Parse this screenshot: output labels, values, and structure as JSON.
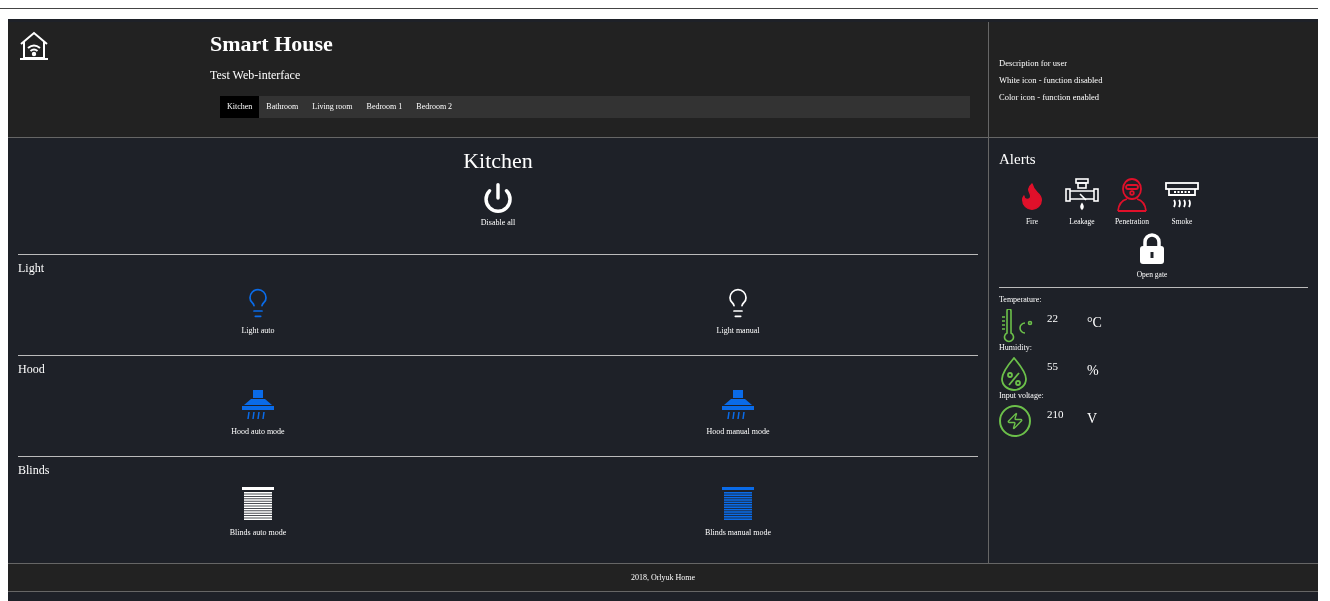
{
  "header": {
    "title": "Smart House",
    "subtitle": "Test Web-interface",
    "tabs": [
      {
        "label": "Kitchen",
        "selected": true
      },
      {
        "label": "Bathroom",
        "selected": false
      },
      {
        "label": "Living room",
        "selected": false
      },
      {
        "label": "Bedroom 1",
        "selected": false
      },
      {
        "label": "Bedroom 2",
        "selected": false
      }
    ]
  },
  "description": [
    "Description for user",
    "White icon - function disabled",
    "Color icon - function enabled"
  ],
  "room": {
    "title": "Kitchen",
    "master": {
      "label": "Disable all"
    }
  },
  "sections": [
    {
      "title": "Light",
      "controls": [
        {
          "kind": "light",
          "label": "Light auto",
          "on": true
        },
        {
          "kind": "light",
          "label": "Light manual",
          "on": false
        }
      ]
    },
    {
      "title": "Hood",
      "controls": [
        {
          "kind": "hood",
          "label": "Hood auto mode",
          "on": true
        },
        {
          "kind": "hood",
          "label": "Hood manual mode",
          "on": true
        }
      ]
    },
    {
      "title": "Blinds",
      "controls": [
        {
          "kind": "blinds",
          "label": "Blinds auto mode",
          "on": false
        },
        {
          "kind": "blinds",
          "label": "Blinds manual mode",
          "on": true
        }
      ]
    }
  ],
  "alerts": {
    "title": "Alerts",
    "items": [
      {
        "kind": "fire",
        "label": "Fire",
        "on": true
      },
      {
        "kind": "leakage",
        "label": "Leakage",
        "on": false
      },
      {
        "kind": "penetration",
        "label": "Penetration",
        "on": true
      },
      {
        "kind": "smoke",
        "label": "Smoke",
        "on": false
      }
    ],
    "gate": {
      "label": "Open gate",
      "on": false
    }
  },
  "sensors": [
    {
      "kind": "temperature",
      "label": "Temperature:",
      "value": "22",
      "unit": "°C"
    },
    {
      "kind": "humidity",
      "label": "Humidity:",
      "value": "55",
      "unit": "%"
    },
    {
      "kind": "voltage",
      "label": "Input voltage:",
      "value": "210",
      "unit": "V"
    }
  ],
  "footer": "2018, Orlyuk Home"
}
